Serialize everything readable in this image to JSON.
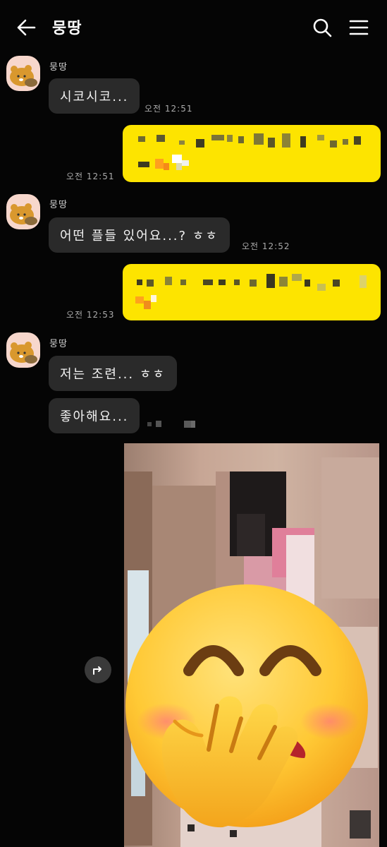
{
  "header": {
    "title": "뭉땅",
    "back_icon": "arrow-left-icon",
    "search_icon": "search-icon",
    "menu_icon": "hamburger-menu-icon"
  },
  "messages": [
    {
      "sender": "뭉땅",
      "text": "시코시코...",
      "time": "오전 12:51"
    },
    {
      "time": "오전 12:51"
    },
    {
      "sender": "뭉땅",
      "text": "어떤 플들 있어요...? ㅎㅎ",
      "time": "오전 12:52"
    },
    {
      "time": "오전 12:53"
    },
    {
      "sender": "뭉땅",
      "text": "저는 조련... ㅎㅎ"
    },
    {
      "text": "좋아해요..."
    }
  ],
  "colors": {
    "background": "#050505",
    "incoming_bubble": "#2a2a2a",
    "outgoing_bubble": "#fde400"
  }
}
